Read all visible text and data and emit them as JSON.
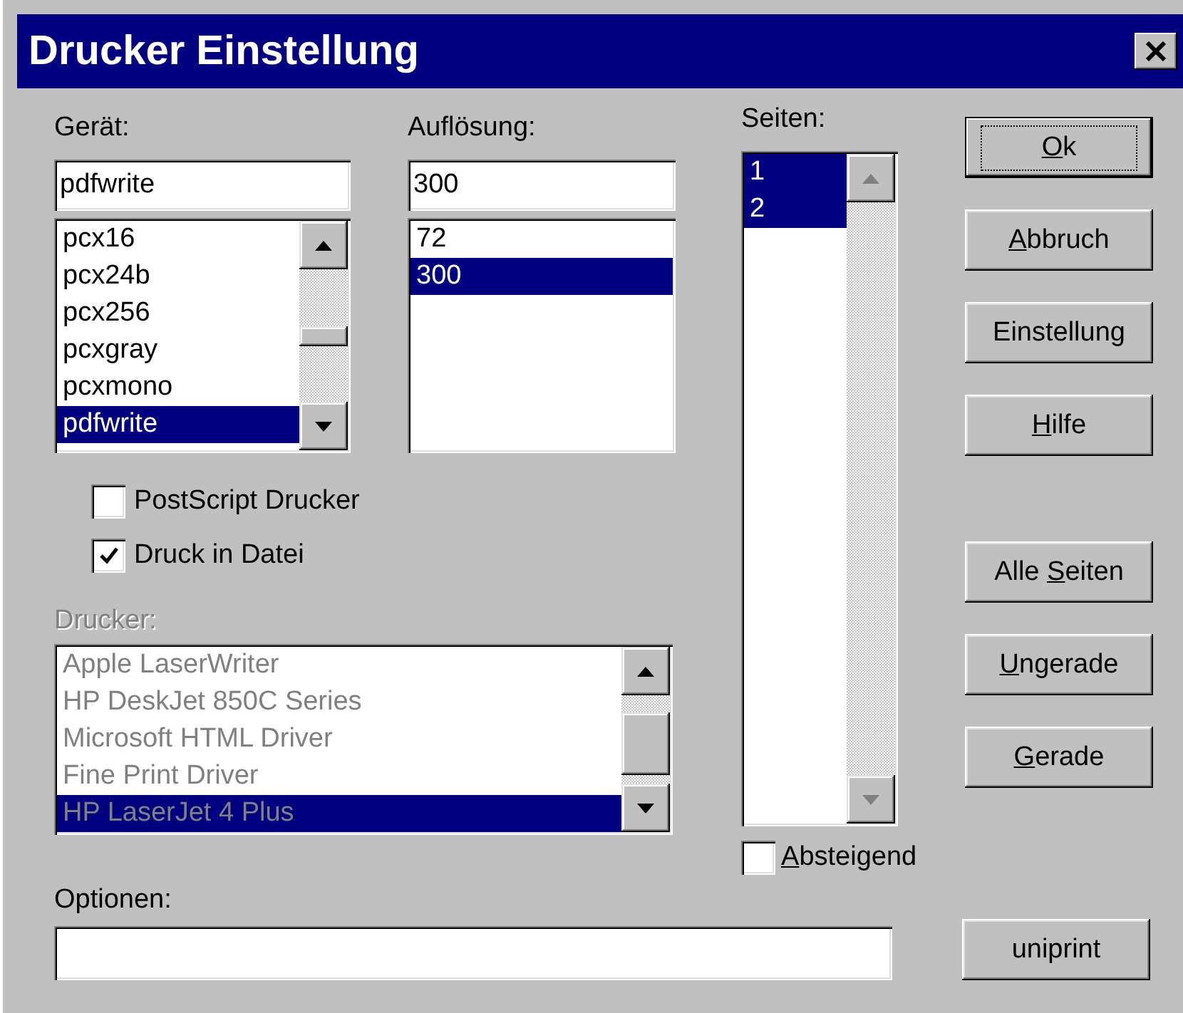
{
  "window": {
    "title": "Drucker Einstellung"
  },
  "device": {
    "label": "Gerät:",
    "value": "pdfwrite",
    "items": [
      {
        "text": "pcx16",
        "selected": false
      },
      {
        "text": "pcx24b",
        "selected": false
      },
      {
        "text": "pcx256",
        "selected": false
      },
      {
        "text": "pcxgray",
        "selected": false
      },
      {
        "text": "pcxmono",
        "selected": false
      },
      {
        "text": "pdfwrite",
        "selected": true
      }
    ]
  },
  "resolution": {
    "label": "Auflösung:",
    "value": "300",
    "items": [
      {
        "text": "72",
        "selected": false
      },
      {
        "text": "300",
        "selected": true
      }
    ]
  },
  "checks": [
    {
      "label": "PostScript Drucker",
      "checked": false
    },
    {
      "label": "Druck in Datei",
      "checked": true
    }
  ],
  "printer": {
    "label": "Drucker:",
    "disabled": true,
    "items": [
      {
        "text": "Apple LaserWriter",
        "selected": false
      },
      {
        "text": "HP DeskJet 850C Series",
        "selected": false
      },
      {
        "text": "Microsoft HTML Driver",
        "selected": false
      },
      {
        "text": "Fine Print Driver",
        "selected": false
      },
      {
        "text": "HP LaserJet 4 Plus",
        "selected": true
      }
    ]
  },
  "pages": {
    "label": "Seiten:",
    "items": [
      {
        "text": "1",
        "selected": true
      },
      {
        "text": "2",
        "selected": true
      }
    ],
    "descending": {
      "label_parts": [
        {
          "text": "A",
          "underlined": true
        },
        {
          "text": "bsteigend",
          "underlined": false
        }
      ],
      "checked": false
    }
  },
  "options": {
    "label": "Optionen:"
  },
  "buttons": [
    {
      "label_parts": [
        {
          "text": "O",
          "underlined": true
        },
        {
          "text": "k",
          "underlined": false
        }
      ],
      "default": true
    },
    {
      "label_parts": [
        {
          "text": "A",
          "underlined": true
        },
        {
          "text": "bbruch",
          "underlined": false
        }
      ],
      "default": false
    },
    {
      "label_parts": [
        {
          "text": "Einstellung",
          "underlined": false
        }
      ],
      "default": false
    },
    {
      "label_parts": [
        {
          "text": "H",
          "underlined": true
        },
        {
          "text": "ilfe",
          "underlined": false
        }
      ],
      "default": false
    },
    {
      "label_parts": [
        {
          "text": "Alle ",
          "underlined": false
        },
        {
          "text": "S",
          "underlined": true
        },
        {
          "text": "eiten",
          "underlined": false
        }
      ],
      "default": false
    },
    {
      "label_parts": [
        {
          "text": "U",
          "underlined": true
        },
        {
          "text": "ngerade",
          "underlined": false
        }
      ],
      "default": false
    },
    {
      "label_parts": [
        {
          "text": "G",
          "underlined": true
        },
        {
          "text": "erade",
          "underlined": false
        }
      ],
      "default": false
    }
  ],
  "extra_button": {
    "label": "uniprint",
    "default": false
  }
}
